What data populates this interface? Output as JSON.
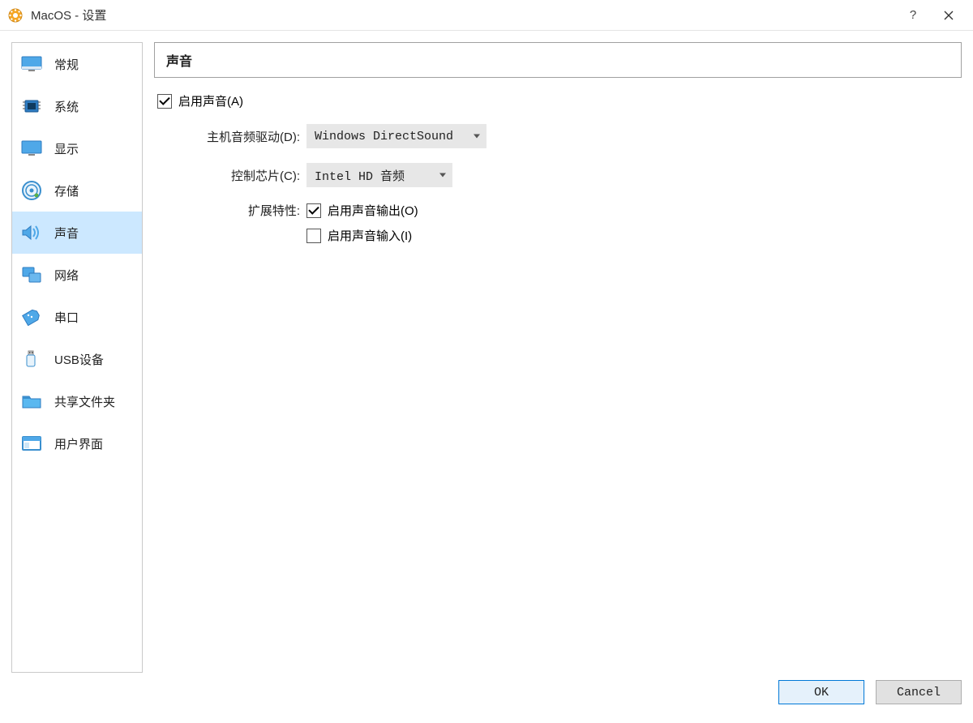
{
  "window": {
    "title": "MacOS - 设置"
  },
  "sidebar": {
    "items": [
      {
        "label": "常规"
      },
      {
        "label": "系统"
      },
      {
        "label": "显示"
      },
      {
        "label": "存储"
      },
      {
        "label": "声音"
      },
      {
        "label": "网络"
      },
      {
        "label": "串口"
      },
      {
        "label": "USB设备"
      },
      {
        "label": "共享文件夹"
      },
      {
        "label": "用户界面"
      }
    ]
  },
  "panel": {
    "title": "声音",
    "enable_audio_label": "启用声音(A)",
    "host_driver_label": "主机音频驱动(D):",
    "host_driver_value": "Windows DirectSound",
    "controller_label": "控制芯片(C):",
    "controller_value": "Intel HD 音频",
    "extended_label": "扩展特性:",
    "enable_output_label": "启用声音输出(O)",
    "enable_input_label": "启用声音输入(I)"
  },
  "buttons": {
    "ok": "OK",
    "cancel": "Cancel"
  }
}
